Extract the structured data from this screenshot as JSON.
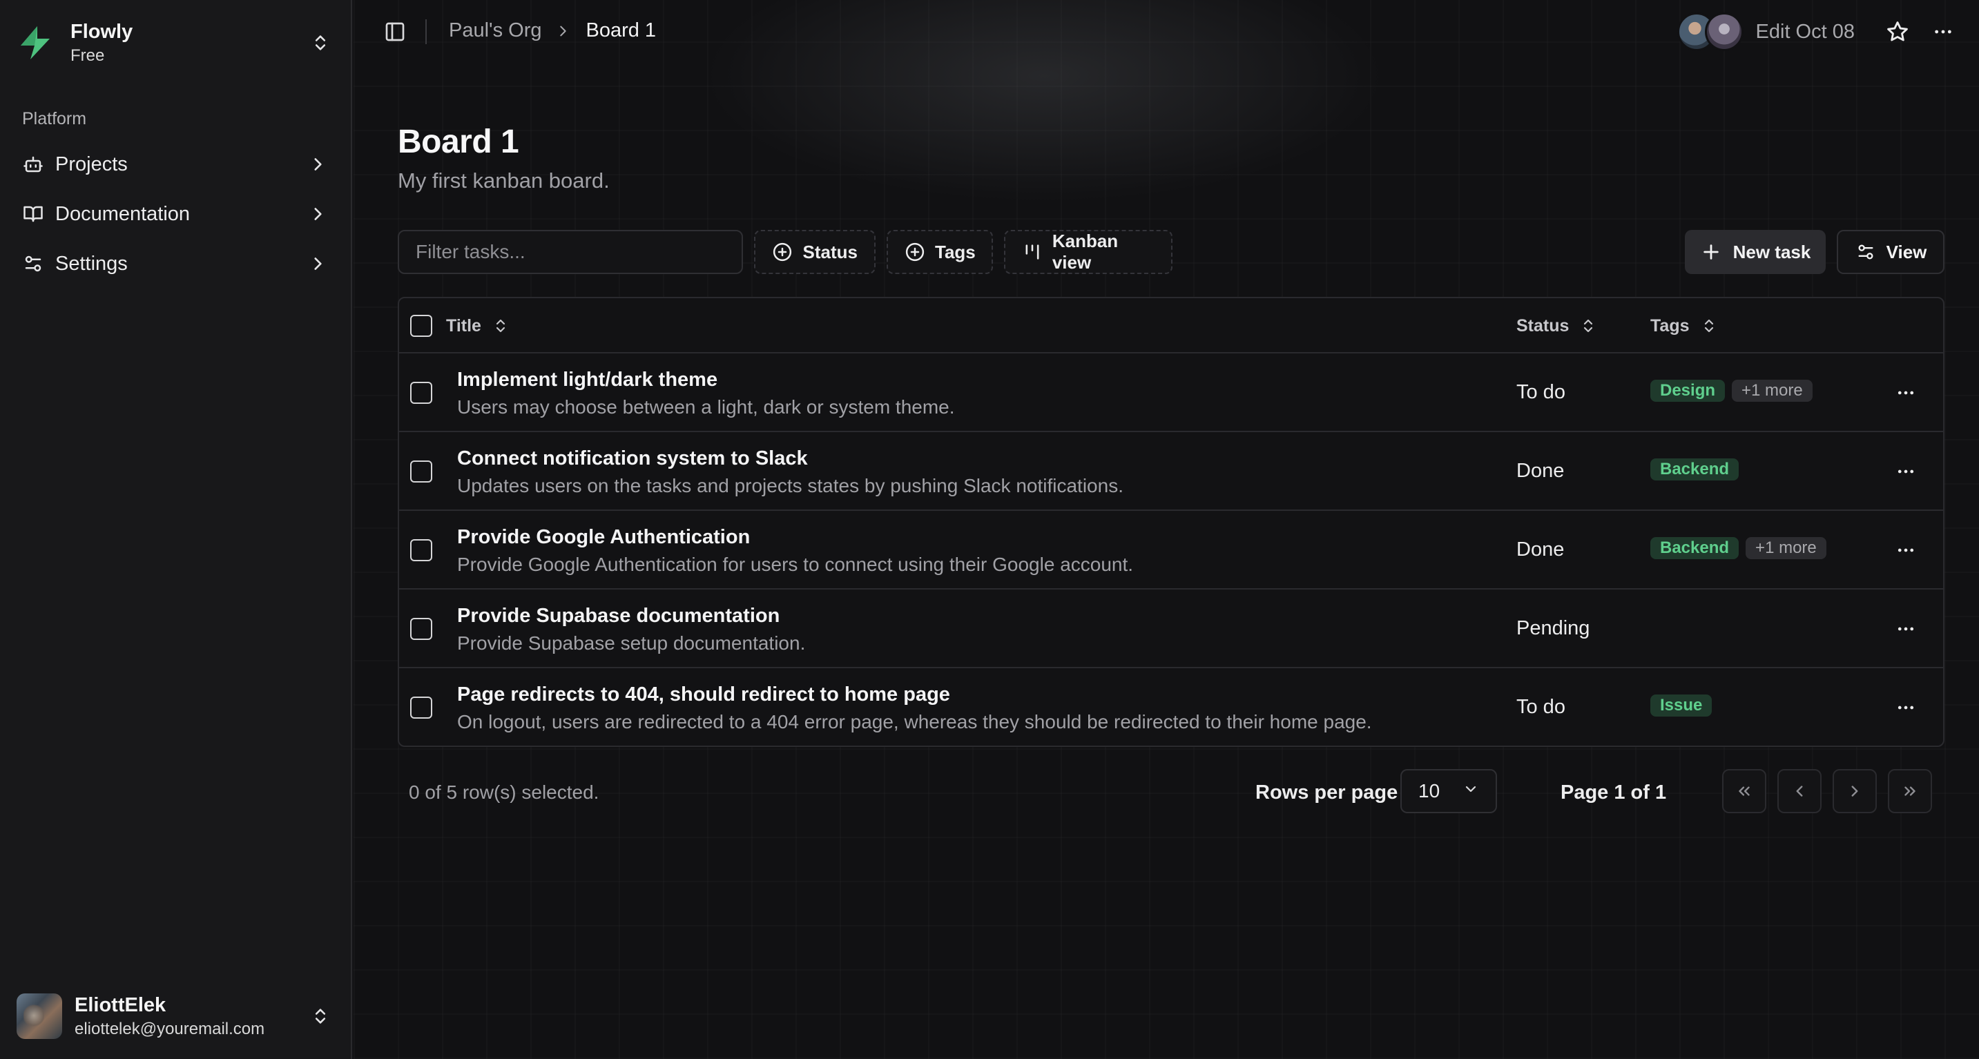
{
  "sidebar": {
    "org": {
      "name": "Flowly",
      "plan": "Free"
    },
    "group_label": "Platform",
    "items": [
      {
        "label": "Projects",
        "icon": "bot-icon"
      },
      {
        "label": "Documentation",
        "icon": "book-icon"
      },
      {
        "label": "Settings",
        "icon": "sliders-icon"
      }
    ],
    "user": {
      "name": "EliottElek",
      "email": "eliottelek@youremail.com"
    }
  },
  "header": {
    "breadcrumb": [
      "Paul's Org",
      "Board 1"
    ],
    "edit_label": "Edit Oct 08"
  },
  "board": {
    "title": "Board 1",
    "description": "My first kanban board."
  },
  "toolbar": {
    "filter_placeholder": "Filter tasks...",
    "status_label": "Status",
    "tags_label": "Tags",
    "kanban_label": "Kanban view",
    "new_task_label": "New task",
    "view_label": "View"
  },
  "table": {
    "columns": {
      "title": "Title",
      "status": "Status",
      "tags": "Tags"
    },
    "rows": [
      {
        "title": "Implement light/dark theme",
        "description": "Users may choose between a light, dark or system theme.",
        "status": "To do",
        "tag": "Design",
        "more": "+1 more"
      },
      {
        "title": "Connect notification system to Slack",
        "description": "Updates users on the tasks and projects states by pushing Slack notifications.",
        "status": "Done",
        "tag": "Backend",
        "more": ""
      },
      {
        "title": "Provide Google Authentication",
        "description": "Provide Google Authentication for users to connect using their Google account.",
        "status": "Done",
        "tag": "Backend",
        "more": "+1 more"
      },
      {
        "title": "Provide Supabase documentation",
        "description": "Provide Supabase setup documentation.",
        "status": "Pending",
        "tag": "",
        "more": ""
      },
      {
        "title": "Page redirects to 404, should redirect to home page",
        "description": "On logout, users are redirected to a 404 error page, whereas they should be redirected to their home page.",
        "status": "To do",
        "tag": "Issue",
        "more": ""
      }
    ]
  },
  "footer": {
    "selection": "0 of 5 row(s) selected.",
    "rows_per_page_label": "Rows per page",
    "rows_per_page_value": "10",
    "page_label": "Page 1 of 1"
  },
  "colors": {
    "background": "#111113",
    "sidebar": "#18181a",
    "accent_green": "#5fcf8d",
    "tag_green_bg": "#1f3a2c"
  }
}
